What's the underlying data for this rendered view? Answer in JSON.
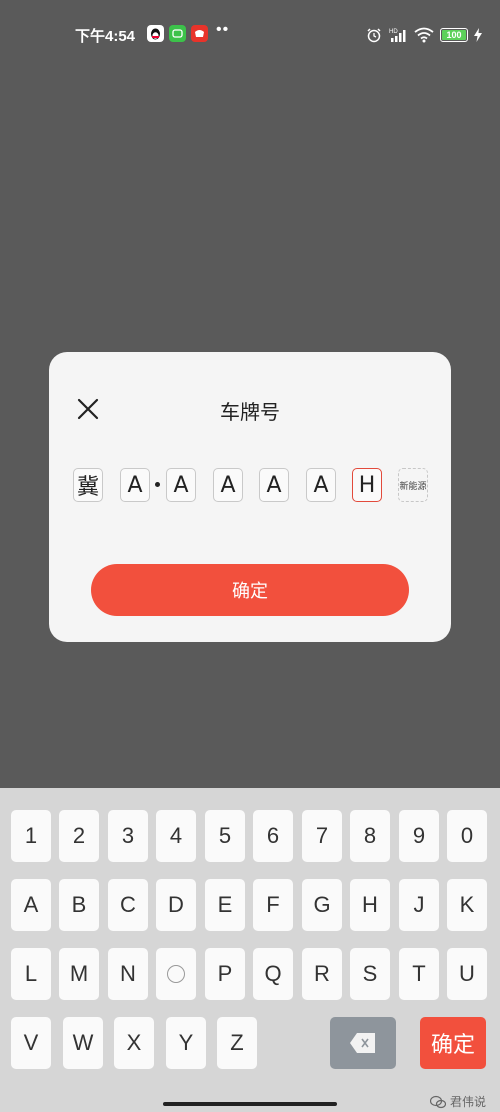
{
  "status_bar": {
    "time": "下午4:54",
    "battery": "100"
  },
  "dialog": {
    "title": "车牌号",
    "plate_chars": [
      "冀",
      "A",
      "A",
      "A",
      "A",
      "A",
      "H"
    ],
    "new_energy_label": "新能源",
    "confirm_label": "确定"
  },
  "keyboard": {
    "row1": [
      "1",
      "2",
      "3",
      "4",
      "5",
      "6",
      "7",
      "8",
      "9",
      "0"
    ],
    "row2": [
      "A",
      "B",
      "C",
      "D",
      "E",
      "F",
      "G",
      "H",
      "J",
      "K"
    ],
    "row3": [
      "L",
      "M",
      "N",
      "",
      "P",
      "Q",
      "R",
      "S",
      "T",
      "U"
    ],
    "row4": [
      "V",
      "W",
      "X",
      "Y",
      "Z"
    ],
    "confirm_label": "确定"
  },
  "watermark": "君伟说",
  "colors": {
    "accent": "#f2503d",
    "active_border": "#e24a3b",
    "backdrop": "#5a5a5a",
    "keyboard_bg": "#d6d6d6"
  }
}
